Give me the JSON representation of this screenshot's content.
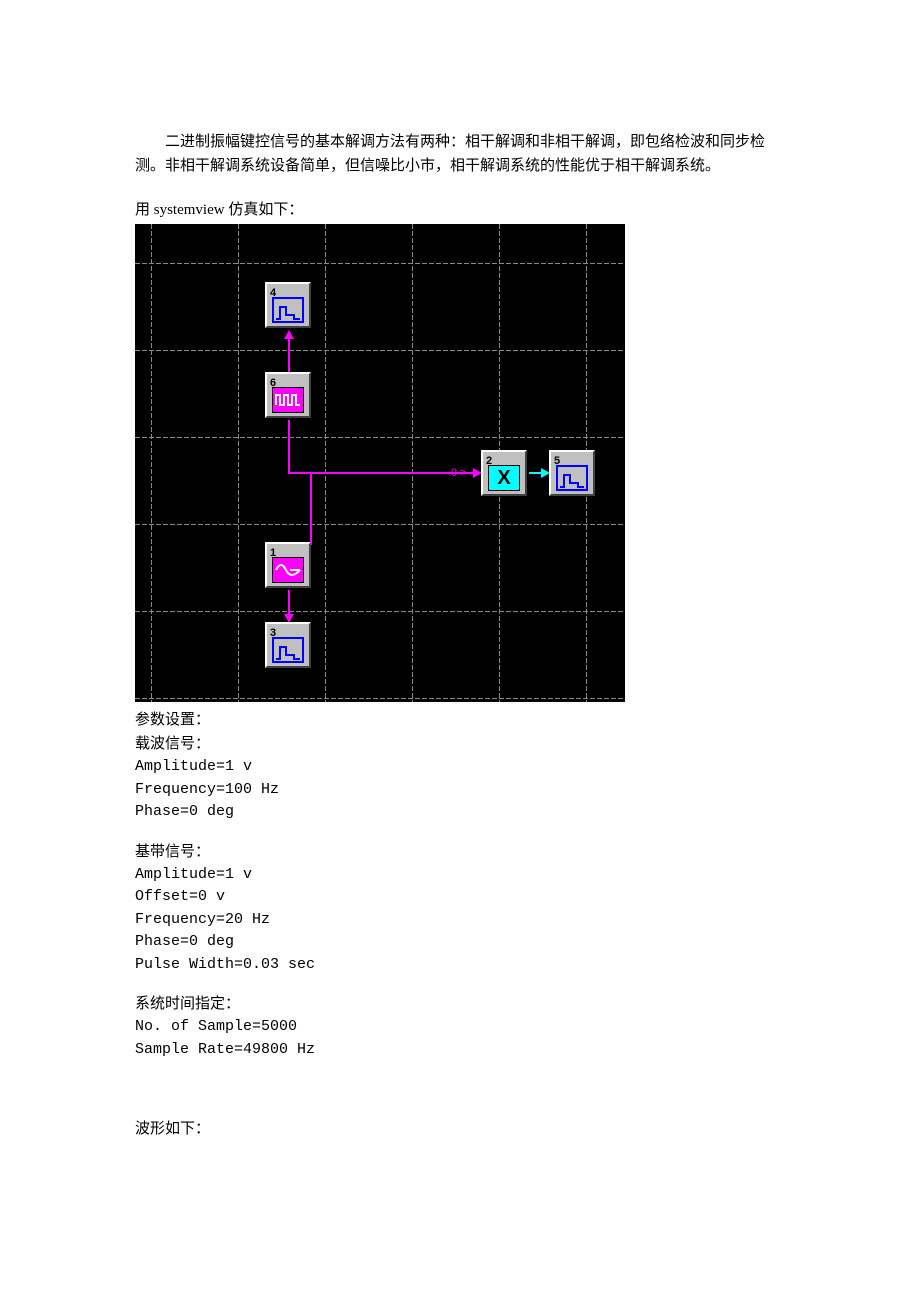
{
  "intro": "二进制振幅键控信号的基本解调方法有两种：相干解调和非相干解调，即包络检波和同步检测。非相干解调系统设备简单，但信噪比小市，相干解调系统的性能优于相干解调系统。",
  "sim_caption": "用 systemview 仿真如下：",
  "tokens": {
    "t4": "4",
    "t6": "6",
    "t2": "2",
    "t5": "5",
    "t1": "1",
    "t3": "3",
    "mult_symbol": "X",
    "port0": "0 >"
  },
  "params": {
    "header": "参数设置：",
    "carrier": {
      "title": "载波信号：",
      "amp": "Amplitude=1 v",
      "freq": "Frequency=100 Hz",
      "phase": "Phase=0 deg"
    },
    "baseband": {
      "title": "基带信号：",
      "amp": "Amplitude=1 v",
      "offset": "Offset=0 v",
      "freq": "Frequency=20 Hz",
      "phase": "Phase=0 deg",
      "pw": "Pulse Width=0.03 sec"
    },
    "timing": {
      "title": "系统时间指定：",
      "samples": "No. of Sample=5000",
      "rate": "Sample Rate=49800 Hz"
    }
  },
  "wave_caption": "波形如下："
}
